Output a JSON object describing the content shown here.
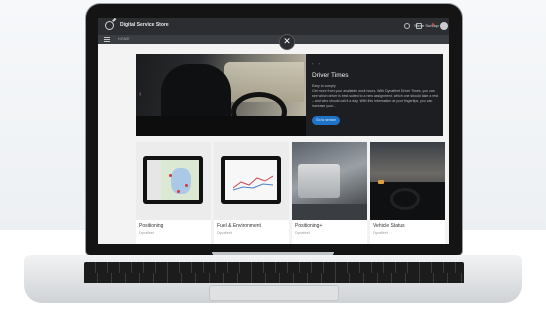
{
  "app": {
    "title": "Digital Service Store",
    "user_name": "Steve Sundqv",
    "breadcrumb": "HOME"
  },
  "hero": {
    "arrows": "‹ ›",
    "title": "Driver Times",
    "description": "Easy to comply\nGet more from your available work hours. With Dynafleet Driver Times, you can see which driver is best suited to a new assignment, which one should take a rest – and who should call it a day. With this information at your fingertips, you can increase your...",
    "cta_label": "Go to service"
  },
  "cards": [
    {
      "label": "Positioning",
      "sub": "Dynafleet"
    },
    {
      "label": "Fuel & Environment",
      "sub": "Dynafleet"
    },
    {
      "label": "Positioning+",
      "sub": "Dynafleet"
    },
    {
      "label": "Vehicle Status",
      "sub": "Dynafleet"
    }
  ],
  "icons": {
    "logo": "volvo-logo-icon",
    "help": "help-icon",
    "settings": "settings-icon",
    "notifications": "bell-icon",
    "menu": "hamburger-menu-icon",
    "close": "close-icon"
  },
  "colors": {
    "appbar": "#2b2d31",
    "cta": "#1e73c8",
    "notification": "#d13b3b"
  }
}
